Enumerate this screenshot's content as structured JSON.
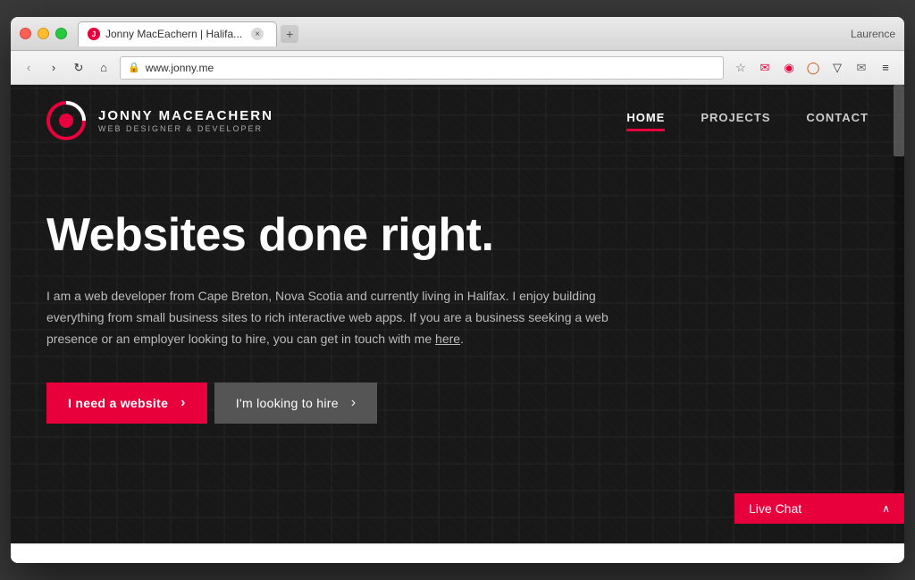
{
  "browser": {
    "tab_title": "Jonny MacEachern | Halifa...",
    "tab_favicon_char": "J",
    "url": "www.jonny.me",
    "user_label": "Laurence",
    "new_tab_icon": "+",
    "nav_back": "‹",
    "nav_forward": "›",
    "nav_refresh": "↻",
    "nav_home": "⌂"
  },
  "site": {
    "logo_name": "JONNY MACEACHERN",
    "logo_subtitle": "WEB DESIGNER & DEVELOPER",
    "nav": {
      "home": "HOME",
      "projects": "PROJECTS",
      "contact": "CONTACT"
    },
    "hero": {
      "title": "Websites done right.",
      "description": "I am a web developer from Cape Breton, Nova Scotia and currently living in Halifax. I enjoy building everything from small business sites to rich interactive web apps. If you are a business seeking a web presence or an employer looking to hire, you can get in touch with me here.",
      "link_text": "here",
      "btn_primary": "I need a website",
      "btn_secondary": "I'm looking to hire"
    },
    "live_chat": {
      "label": "Live Chat",
      "chevron": "∧"
    }
  }
}
